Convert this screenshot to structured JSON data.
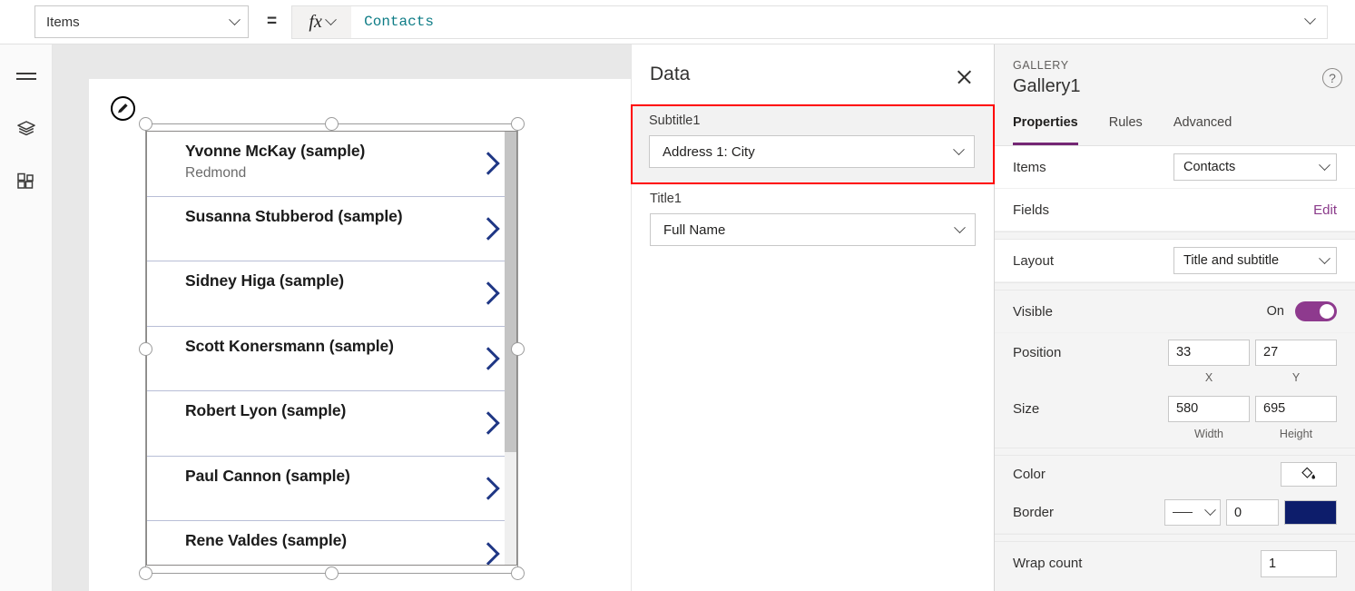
{
  "formula_bar": {
    "property_selected": "Items",
    "equals": "=",
    "fx_label": "fx",
    "formula_value": "Contacts"
  },
  "left_rail": {
    "items": [
      {
        "name": "menu-icon",
        "label": "Menu"
      },
      {
        "name": "tree-view-icon",
        "label": "Tree view"
      },
      {
        "name": "insert-icon",
        "label": "Insert"
      }
    ]
  },
  "canvas": {
    "gallery": {
      "items": [
        {
          "title": "Yvonne McKay (sample)",
          "subtitle": "Redmond"
        },
        {
          "title": "Susanna Stubberod (sample)",
          "subtitle": ""
        },
        {
          "title": "Sidney Higa (sample)",
          "subtitle": ""
        },
        {
          "title": "Scott Konersmann (sample)",
          "subtitle": ""
        },
        {
          "title": "Robert Lyon (sample)",
          "subtitle": ""
        },
        {
          "title": "Paul Cannon (sample)",
          "subtitle": ""
        },
        {
          "title": "Rene Valdes (sample)",
          "subtitle": ""
        }
      ]
    }
  },
  "data_panel": {
    "title": "Data",
    "close_label": "Close",
    "fields": [
      {
        "label": "Subtitle1",
        "value": "Address 1: City",
        "highlighted": true
      },
      {
        "label": "Title1",
        "value": "Full Name",
        "highlighted": false
      }
    ]
  },
  "right_panel": {
    "kicker": "GALLERY",
    "name": "Gallery1",
    "help_label": "?",
    "tabs": [
      {
        "label": "Properties",
        "active": true
      },
      {
        "label": "Rules",
        "active": false
      },
      {
        "label": "Advanced",
        "active": false
      }
    ],
    "items_label": "Items",
    "items_value": "Contacts",
    "fields_label": "Fields",
    "fields_edit": "Edit",
    "layout_label": "Layout",
    "layout_value": "Title and subtitle",
    "visible_label": "Visible",
    "visible_state": "On",
    "position_label": "Position",
    "position_x": "33",
    "position_y": "27",
    "position_x_caption": "X",
    "position_y_caption": "Y",
    "size_label": "Size",
    "size_width": "580",
    "size_height": "695",
    "size_width_caption": "Width",
    "size_height_caption": "Height",
    "color_label": "Color",
    "border_label": "Border",
    "border_thickness": "0",
    "border_color": "#0d1d6b",
    "wrap_count_label": "Wrap count",
    "wrap_count_value": "1"
  },
  "theme": {
    "accent_purple": "#742774",
    "toggle_on": "#8e3a8e",
    "highlight_red": "#ff0000",
    "formula_teal": "#0e7c86",
    "arrow_navy": "#1f3785"
  }
}
